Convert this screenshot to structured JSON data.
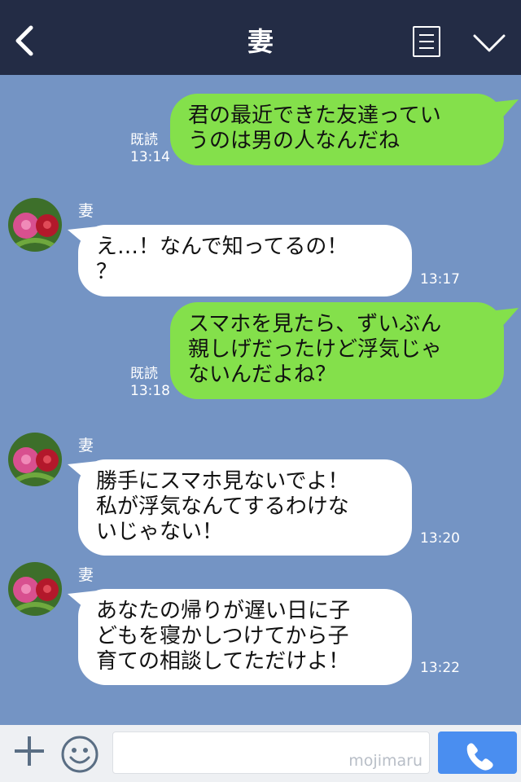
{
  "header": {
    "title": "妻"
  },
  "messages": [
    {
      "kind": "out",
      "text": "君の最近できた友達ってい\nうのは男の人なんだね",
      "read": "既読",
      "time": "13:14"
    },
    {
      "kind": "in",
      "sender": "妻",
      "text": "え…！なんで知ってるの！\n？",
      "time": "13:17"
    },
    {
      "kind": "out",
      "text": "スマホを見たら、ずいぶん\n親しげだったけど浮気じゃ\nないんだよね？",
      "read": "既読",
      "time": "13:18"
    },
    {
      "kind": "in",
      "sender": "妻",
      "text": "勝手にスマホ見ないでよ！\n私が浮気なんてするわけな\nいじゃない！",
      "time": "13:20"
    },
    {
      "kind": "in",
      "sender": "妻",
      "text": "あなたの帰りが遅い日に子\nどもを寝かしつけてから子\n育ての相談してただけよ！",
      "time": "13:22"
    }
  ],
  "footer": {
    "watermark": "mojimaru"
  },
  "icons": {
    "back": "chevron-left-icon",
    "menu": "menu-list-icon",
    "collapse": "chevron-down-icon",
    "add": "plus-icon",
    "emoji": "smiley-icon",
    "call": "phone-icon",
    "avatar": "rose-avatar"
  },
  "colors": {
    "header": "#232c45",
    "background": "#7494c4",
    "outgoing": "#84e04b",
    "incoming": "#ffffff",
    "call_button": "#4a8ef0"
  }
}
